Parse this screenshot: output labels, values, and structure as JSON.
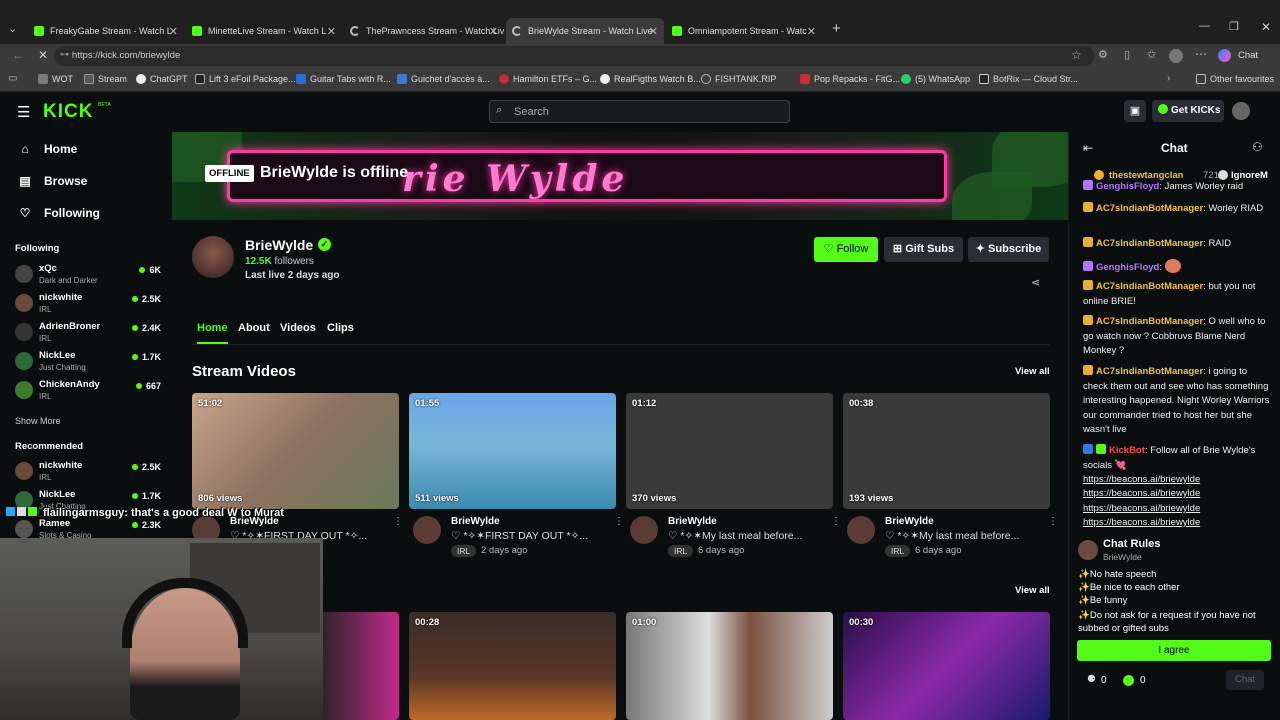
{
  "browser": {
    "tabs": [
      {
        "title": "FreakyGabe Stream - Watch L",
        "active": false
      },
      {
        "title": "MinetteLive Stream - Watch L",
        "active": false
      },
      {
        "title": "ThePrawncess Stream - Watch Live",
        "active": false
      },
      {
        "title": "BrieWylde Stream - Watch Live",
        "active": true
      },
      {
        "title": "Omniampotent Stream - Watc",
        "active": false
      }
    ],
    "url": "https://kick.com/briewylde",
    "profile_chat": "Chat",
    "bookmarks": [
      "WOT",
      "Stream",
      "ChatGPT",
      "Lift 3 eFoil Package...",
      "Guitar Tabs with R...",
      "Guichet d'accès à...",
      "Hamilton ETFs – G...",
      "RealFigths Watch B...",
      "FISHTANK.RIP",
      "Pop Repacks - FitG...",
      "(5) WhatsApp",
      "BotRix — Cloud Str..."
    ],
    "other_favourites": "Other favourites"
  },
  "topnav": {
    "logo": "KICK",
    "logo_badge": "BETA",
    "search_placeholder": "Search",
    "get_kicks": "Get KICKs"
  },
  "sidebar": {
    "nav": [
      {
        "label": "Home",
        "icon": "home-icon"
      },
      {
        "label": "Browse",
        "icon": "browse-icon"
      },
      {
        "label": "Following",
        "icon": "heart-icon"
      }
    ],
    "following_title": "Following",
    "following": [
      {
        "name": "xQc",
        "category": "Dark and Darker",
        "viewers": "6K"
      },
      {
        "name": "nickwhite",
        "category": "IRL",
        "viewers": "2.5K"
      },
      {
        "name": "AdrienBroner",
        "category": "IRL",
        "viewers": "2.4K"
      },
      {
        "name": "NickLee",
        "category": "Just Chatting",
        "viewers": "1.7K"
      },
      {
        "name": "ChickenAndy",
        "category": "IRL",
        "viewers": "667"
      }
    ],
    "show_more": "Show More",
    "recommended_title": "Recommended",
    "recommended": [
      {
        "name": "nickwhite",
        "category": "IRL",
        "viewers": "2.5K"
      },
      {
        "name": "NickLee",
        "category": "Just Chatting",
        "viewers": "1.7K"
      },
      {
        "name": "Ramee",
        "category": "Slots & Casino",
        "viewers": "2.3K"
      }
    ]
  },
  "banner": {
    "offline_badge": "OFFLINE",
    "offline_text": "BrieWylde is offline",
    "sign_text": "rie Wylde"
  },
  "channel": {
    "name": "BrieWylde",
    "followers_count": "12.5K",
    "followers_label": "followers",
    "last_live": "Last live 2 days ago",
    "follow": "Follow",
    "gift_subs": "Gift Subs",
    "subscribe": "Subscribe",
    "tabs": [
      "Home",
      "About",
      "Videos",
      "Clips"
    ]
  },
  "stream_videos": {
    "title": "Stream Videos",
    "view_all": "View all",
    "videos": [
      {
        "duration": "51:02",
        "views": "806 views",
        "author": "BrieWylde",
        "title": "♡ *✧✶FIRST DAY OUT *✧...",
        "tag": "IRL",
        "ago": "2 days ago"
      },
      {
        "duration": "01:55",
        "views": "511 views",
        "author": "BrieWylde",
        "title": "♡ *✧✶FIRST DAY OUT *✧...",
        "tag": "IRL",
        "ago": "2 days ago"
      },
      {
        "duration": "01:12",
        "views": "370 views",
        "author": "BrieWylde",
        "title": "♡ *✧✶My last meal before...",
        "tag": "IRL",
        "ago": "6 days ago"
      },
      {
        "duration": "00:38",
        "views": "193 views",
        "author": "BrieWylde",
        "title": "♡ *✧✶My last meal before...",
        "tag": "IRL",
        "ago": "6 days ago"
      }
    ]
  },
  "clips": {
    "view_all": "View all",
    "items": [
      {
        "duration": ""
      },
      {
        "duration": "00:28"
      },
      {
        "duration": "01:00"
      },
      {
        "duration": "00:30"
      }
    ]
  },
  "chat": {
    "title": "Chat",
    "pinned_user": "thestewtangclan",
    "pinned_count": "721",
    "ignore": "IgnoreM",
    "messages": [
      {
        "user": "GenghisFloyd",
        "text": "James Worley raid",
        "color": "#b574ff"
      },
      {
        "user": "AC7sIndianBotManager",
        "text": "Worley RIAD",
        "color": "#f0c040"
      },
      {
        "user": "AC7sIndianBotManager",
        "text": "RAID",
        "color": "#f0c040"
      },
      {
        "user": "GenghisFloyd",
        "text": "",
        "color": "#b574ff"
      },
      {
        "user": "AC7sIndianBotManager",
        "text": "but you not online BRIE!",
        "color": "#f0c040"
      },
      {
        "user": "AC7sIndianBotManager",
        "text": "O well who to go watch now ? Cobbruvs Blame Nerd Monkey ?",
        "color": "#f0c040"
      },
      {
        "user": "AC7sIndianBotManager",
        "text": "i going to check them out and see who has something interesting happened. Night Worley Warriors our commander tried to host her but she wasn't live",
        "color": "#f0c040"
      },
      {
        "user": "KickBot",
        "text": "Follow all of Brie Wylde's socials 💘",
        "color": "#ff4a4a"
      }
    ],
    "links": [
      "https://beacons.ai/briewylde",
      "https://beacons.ai/briewylde",
      "https://beacons.ai/briewylde",
      "https://beacons.ai/briewylde"
    ],
    "rules_title": "Chat Rules",
    "rules_author": "BrieWylde",
    "rules": [
      "✨No hate speech",
      "✨Be nice to each other",
      "✨Be funny",
      "✨Do not ask for a request if you have not subbed or gifted subs"
    ],
    "agree": "I agree",
    "count_a": "0",
    "count_b": "0",
    "chat_button": "Chat"
  },
  "overlay": {
    "user": "flailingarmsguy",
    "text": ": that's a good deal W to Murat"
  },
  "colors": {
    "accent": "#53fc18",
    "bg": "#0b0e0f",
    "offline_badge": "#ffffff"
  }
}
